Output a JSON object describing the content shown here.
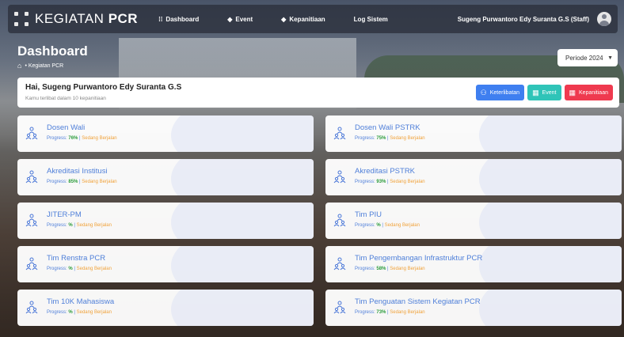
{
  "navbar": {
    "brand_prefix": "KEGIATAN",
    "brand_bold": "PCR",
    "items": [
      {
        "icon": "grid-icon",
        "glyph": "⁞⁞",
        "label": "Dashboard"
      },
      {
        "icon": "diamond-icon",
        "glyph": "◆",
        "label": "Event"
      },
      {
        "icon": "diamond-icon",
        "glyph": "◆",
        "label": "Kepanitiaan"
      },
      {
        "icon": "",
        "glyph": "",
        "label": "Log Sistem"
      }
    ],
    "user": "Sugeng Purwantoro Edy Suranta G.S (Staff)"
  },
  "header": {
    "title": "Dashboard",
    "breadcrumb": "Kegiatan PCR",
    "period": "Periode 2024"
  },
  "greeting": {
    "title": "Hai, Sugeng Purwantoro Edy Suranta G.S",
    "subtitle": "Kamu terlibat dalam 10 kepanitiaan",
    "buttons": [
      {
        "label": "Keterlibatan",
        "color": "#3f7ff0"
      },
      {
        "label": "Event",
        "color": "#2fc4b8"
      },
      {
        "label": "Kepanitiaan",
        "color": "#ef3a4f"
      }
    ]
  },
  "cards": [
    {
      "title": "Dosen Wali",
      "progress_label": "Progress:",
      "progress": "76%",
      "sep": "|",
      "status": "Sedang Berjalan"
    },
    {
      "title": "Dosen Wali PSTRK",
      "progress_label": "Progress:",
      "progress": "75%",
      "sep": "|",
      "status": "Sedang Berjalan"
    },
    {
      "title": "Akreditasi Institusi",
      "progress_label": "Progress:",
      "progress": "85%",
      "sep": "|",
      "status": "Sedang Berjalan"
    },
    {
      "title": "Akreditasi PSTRK",
      "progress_label": "Progress:",
      "progress": "93%",
      "sep": "|",
      "status": "Sedang Berjalan"
    },
    {
      "title": "JITER-PM",
      "progress_label": "Progress:",
      "progress": "%",
      "sep": "|",
      "status": "Sedang Berjalan"
    },
    {
      "title": "Tim PIU",
      "progress_label": "Progress:",
      "progress": "%",
      "sep": "|",
      "status": "Sedang Berjalan"
    },
    {
      "title": "Tim Renstra PCR",
      "progress_label": "Progress:",
      "progress": "%",
      "sep": "|",
      "status": "Sedang Berjalan"
    },
    {
      "title": "Tim Pengembangan Infrastruktur PCR",
      "progress_label": "Progress:",
      "progress": "58%",
      "sep": "|",
      "status": "Sedang Berjalan"
    },
    {
      "title": "Tim 10K Mahasiswa",
      "progress_label": "Progress:",
      "progress": "%",
      "sep": "|",
      "status": "Sedang Berjalan"
    },
    {
      "title": "Tim Penguatan Sistem Kegiatan PCR",
      "progress_label": "Progress:",
      "progress": "73%",
      "sep": "|",
      "status": "Sedang Berjalan"
    }
  ]
}
